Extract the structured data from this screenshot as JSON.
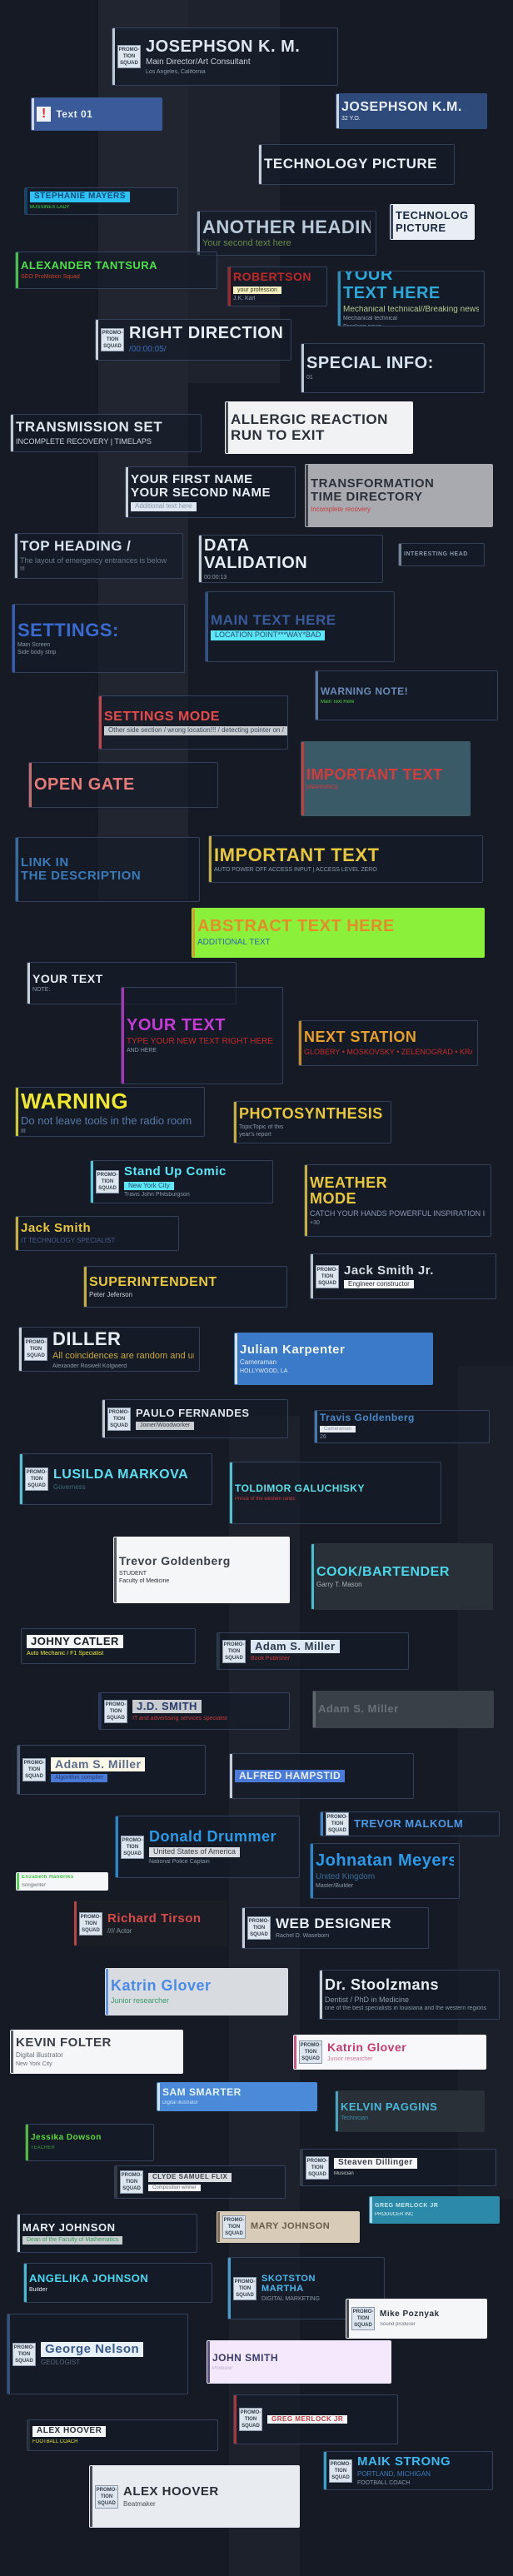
{
  "logo_text": "PROMO-TION SQUAD",
  "colors": {
    "background": "#151a25"
  },
  "lower_thirds": [
    {
      "title": "JOSEPHSON K. M.",
      "subtitle": "Main Director/Art Consultant",
      "extra": [
        "Los Angeles, California"
      ],
      "color": "#dce6f0",
      "sub_color": "#c8d2dc",
      "logo": true
    },
    {
      "title": "Text 01",
      "color": "#e6eef8",
      "bg": "#3a5a9a",
      "icon": "exclamation-icon"
    },
    {
      "title": "JOSEPHSON K.M.",
      "extra": [
        "32 Y.O."
      ],
      "color": "#e8eef6",
      "bg": "#2e4a7a"
    },
    {
      "title": "TECHNOLOGY PICTURE",
      "color": "#e8eef4"
    },
    {
      "title": "STEPHANIE MAYERS",
      "subtitle": "BUSSINES LADY",
      "color": "#0d4b7a",
      "title_bg": "#2fc3f5",
      "sub_color": "#3ddc4a"
    },
    {
      "title": "ANOTHER HEADING",
      "subtitle": "Your second text here",
      "color": "#b8c8d8",
      "sub_color": "#6a8a4a"
    },
    {
      "title": "TECHNOLOGY",
      "title2": "PICTURE",
      "color": "#1a2a40",
      "bg": "#e8eef4"
    },
    {
      "title": "ALEXANDER TANTSURA",
      "subtitle": "SEO ProMotion Squad",
      "color": "#4ee04a",
      "sub_color": "#c8402a"
    },
    {
      "title": "ROBERTSON",
      "subtitle": "your profession",
      "extra": [
        "J.K. Karl"
      ],
      "color": "#c02828",
      "sub_color": "#3a3a20",
      "sub_bg": "#f4f0c0"
    },
    {
      "title": "YOUR",
      "title2": "TEXT HERE",
      "subtitle": "Mechanical technical//Breaking news",
      "extra": [
        "Mechanical technical",
        "Breaking news"
      ],
      "color": "#2aa8d8",
      "sub_color": "#b8c890"
    },
    {
      "title": "RIGHT DIRECTION",
      "subtitle": "/00:00:05/",
      "color": "#e8eef4",
      "sub_color": "#3a6ab8",
      "logo": true
    },
    {
      "title": "SPECIAL INFO:",
      "extra": [
        "01"
      ],
      "color": "#d8e4f0"
    },
    {
      "title": "TRANSMISSION SET",
      "subtitle": "INCOMPLETE RECOVERY | TIMELAPS",
      "color": "#e0e8f0",
      "sub_color": "#c8d2dc"
    },
    {
      "title": "ALLERGIC REACTION",
      "title2": "RUN TO EXIT",
      "color": "#2a3038",
      "bg": "#f0f2f4"
    },
    {
      "title": "YOUR FIRST NAME",
      "title2": "YOUR SECOND NAME",
      "subtitle": "Additional text here",
      "color": "#e8eef6",
      "sub_color": "#8a98aa",
      "sub_bg": "#dce6f0"
    },
    {
      "title": "TRANSFORMATION",
      "title2": "TIME DIRECTORY",
      "subtitle": "Incomplete recovery",
      "color": "#2a3038",
      "bg": "#a8aab0",
      "sub_color": "#c83a3a"
    },
    {
      "title": "TOP HEADING /",
      "subtitle": "The layout of emergency entrances is below",
      "extra": [
        "!!!"
      ],
      "color": "#d8e4f0",
      "sub_color": "#6a7888"
    },
    {
      "title": "DATA",
      "title2": "VALIDATION",
      "extra": [
        "00:00:13"
      ],
      "color": "#e8eef6"
    },
    {
      "title": "INTERESTING HEAD",
      "color": "#8a98a8"
    },
    {
      "title": "SETTINGS:",
      "extra": [
        "Main Screen",
        "Side body strip"
      ],
      "color": "#3a6ad0"
    },
    {
      "title": "MAIN TEXT HERE",
      "subtitle": "LOCATION POINT***WAY*BAD",
      "color": "#3a5a9a",
      "sub_color": "#2a4a6a",
      "sub_bg": "#5ae8f8"
    },
    {
      "title": "WARNING NOTE!",
      "subtitle": "Main Text Here",
      "color": "#6a8ab8",
      "sub_color": "#4ad43a"
    },
    {
      "title": "SETTINGS MODE",
      "subtitle": "Other side section / wrong location!!! / detecting pointer on /",
      "color": "#e84a4a",
      "sub_color": "#3a4a5a",
      "sub_bg": "#c8ccd0"
    },
    {
      "title": "IMPORTANT TEXT",
      "extra": [
        "[WARNING]"
      ],
      "color": "#d83a3a",
      "bg": "#3a5a68"
    },
    {
      "title": "OPEN GATE",
      "color": "#e87a7a"
    },
    {
      "title": "LINK IN",
      "title2": "THE DESCRIPTION",
      "color": "#3a7ab8"
    },
    {
      "title": "IMPORTANT TEXT",
      "extra": [
        "AUTO POWER OFF ACCESS INPUT | ACCESS LEVEL ZERO"
      ],
      "color": "#e8c83a"
    },
    {
      "title": "ABSTRACT TEXT HERE",
      "subtitle": "ADDITIONAL TEXT",
      "color": "#e88a2a",
      "bg": "#8af03a",
      "sub_color": "#2a6aa8"
    },
    {
      "title": "YOUR TEXT",
      "extra": [
        "NOTE:"
      ],
      "color": "#e8eef6"
    },
    {
      "title": "YOUR TEXT",
      "subtitle": "TYPE YOUR NEW TEXT RIGHT HERE",
      "extra": [
        "AND HERE"
      ],
      "color": "#c83ad8",
      "sub_color": "#c82a2a"
    },
    {
      "title": "NEXT STATION",
      "subtitle": "GLOBERY • MOSKOVSKY • ZELENOGRAD • KRASNODAR",
      "color": "#e8a02a",
      "sub_color": "#c82a2a"
    },
    {
      "title": "WARNING",
      "subtitle": "Do not leave tools in the radio room",
      "extra": [
        "III"
      ],
      "color": "#f0e82a",
      "sub_color": "#5a7aa8"
    },
    {
      "title": "PHOTOSYNTHESIS",
      "extra": [
        "TopicTopic of this",
        "year's report"
      ],
      "color": "#e8c83a"
    },
    {
      "title": "Stand Up Comic",
      "subtitle": "New York City",
      "extra": [
        "Travis John Phitsburgson"
      ],
      "color": "#5ae8f8",
      "sub_color": "#2a4a6a",
      "sub_bg": "#5ae8f8",
      "logo": true
    },
    {
      "title": "WEATHER",
      "title2": "MODE",
      "subtitle": "CATCH YOUR HANDS POWERFUL INSPIRATION IS PUT INTO YOUR CREATIVE TOOLS THAT GIVE YOU ABSOLUTE CONTROL OVER YOUR TEXT THEIR HELP YOU",
      "extra": [
        "+30"
      ],
      "color": "#e8c83a",
      "sub_color": "#8a98b8"
    },
    {
      "title": "Jack Smith",
      "subtitle": "IT TECHNOLOGY SPECIALIST",
      "color": "#e8c83a",
      "sub_color": "#4a5a8a"
    },
    {
      "title": "SUPERINTENDENT",
      "subtitle": "Peter Jeferson",
      "color": "#e8c83a",
      "sub_color": "#c8d0d8"
    },
    {
      "title": "Jack Smith Jr.",
      "subtitle": "Engineer constructor",
      "color": "#d8dee6",
      "sub_color": "#2a3038",
      "sub_bg": "#f4f6f8",
      "logo": true
    },
    {
      "title": "DILLER",
      "subtitle": "All coincidences are random and undeniable",
      "extra": [
        "Alexander Roswell Kolgwerd"
      ],
      "color": "#e8eef6",
      "sub_color": "#c8a83a",
      "logo": true
    },
    {
      "title": "Julian Karpenter",
      "subtitle": "Cameraman",
      "extra": [
        "HOLLYWOOD, LA"
      ],
      "color": "#f0f4f8",
      "bg": "#3a7ac8",
      "sub_color": "#e0e8f0"
    },
    {
      "title": "PAULO FERNANDES",
      "subtitle": "Joiner/Woodworker",
      "color": "#e0e6ec",
      "sub_color": "#3a4048",
      "sub_bg": "#c8ccd0",
      "logo": true
    },
    {
      "title": "Travis Goldenberg",
      "subtitle": "Cameraman",
      "extra": [
        "26"
      ],
      "color": "#4a88c8",
      "sub_color": "#8a98a8",
      "sub_bg": "#e8ecf0"
    },
    {
      "title": "LUSILDA MARKOVA",
      "subtitle": "Governess",
      "color": "#5ae0f0",
      "sub_color": "#3a6a7a",
      "logo": true
    },
    {
      "title": "TOLDIMOR GALUCHISKY",
      "subtitle": "Prince of the western lands",
      "color": "#5ae0e8",
      "sub_color": "#c83a3a"
    },
    {
      "title": "Trevor Goldenberg",
      "subtitle": "STUDENT",
      "extra": [
        "Faculty of Medicine"
      ],
      "color": "#3a4048",
      "bg": "#f4f6f8",
      "sub_color": "#2a3038"
    },
    {
      "title": "COOK/BARTENDER",
      "subtitle": "Garry T. Mason",
      "color": "#4ad8e8",
      "bg": "#2a3038",
      "sub_color": "#a8b0b8"
    },
    {
      "title": "JOHNY CATLER",
      "subtitle": "Auto Mechanic / F1 Specialist",
      "color": "#1a1e24",
      "title_bg": "#f4f6f8",
      "sub_color": "#e8e83a"
    },
    {
      "title": "Adam S. Miller",
      "subtitle": "Book Publisher",
      "color": "#2a3848",
      "title_bg": "#dce8f4",
      "sub_color": "#c83a3a",
      "logo": true
    },
    {
      "title": "J.D. SMITH",
      "subtitle": "IT and advertising services specialist",
      "color": "#2a3a68",
      "title_bg": "#c8ccd0",
      "sub_color": "#c83a3a",
      "logo": true
    },
    {
      "title": "Adam S. Miller",
      "color": "#6a7078",
      "bg": "#3a4048"
    },
    {
      "title": "Adam S. Miller",
      "subtitle": "Algorithm compiler",
      "color": "#5a6a8a",
      "title_bg": "#fcf8e8",
      "sub_color": "#2a3a6a",
      "sub_bg": "#4a7ad8",
      "logo": true
    },
    {
      "title": "ALFRED HAMPSTID",
      "color": "#e8eef6",
      "title_bg": "#4a7ad8"
    },
    {
      "title": "TREVOR MALKOLM",
      "color": "#4a9ae8",
      "logo": true
    },
    {
      "title": "Donald Drummer",
      "subtitle": "United States of America",
      "extra": [
        "National Police Captain"
      ],
      "color": "#2a9ae8",
      "sub_color": "#3a4048",
      "sub_bg": "#d8dce0",
      "logo": true
    },
    {
      "title": "Elizabeth Handriks",
      "subtitle": "Songwriter",
      "color": "#3ac83a",
      "bg": "#f4f6f8",
      "sub_color": "#6a7078"
    },
    {
      "title": "Johnatan Meyers",
      "subtitle": "United Kingdom",
      "extra": [
        "Master/Builder"
      ],
      "color": "#2a9ae8",
      "sub_color": "#3a6a98"
    },
    {
      "title": "Richard Tirson",
      "subtitle": "//// Actor",
      "color": "#d84a4a",
      "bg": "#1a1e24",
      "sub_color": "#8a98a8",
      "logo": true
    },
    {
      "title": "WEB DESIGNER",
      "extra": [
        "Rachel D. Waseborn"
      ],
      "color": "#e8eef6",
      "logo": true
    },
    {
      "title": "Katrin Glover",
      "subtitle": "Junior researcher",
      "color": "#4a8ae8",
      "bg": "#d8dce0",
      "sub_color": "#3a9a6a"
    },
    {
      "title": "Dr. Stoolzmans",
      "subtitle": "Dentist / PhD in Medicine",
      "extra": [
        "one of the best specialists in louisiana and the western regions"
      ],
      "color": "#e8eef6",
      "sub_color": "#8a98a8"
    },
    {
      "title": "KEVIN FOLTER",
      "subtitle": "Digital illustrator",
      "extra": [
        "New York City"
      ],
      "color": "#3a4048",
      "bg": "#f4f6f8",
      "sub_color": "#6a7078"
    },
    {
      "title": "Katrin Glover",
      "subtitle": "Junior researcher",
      "color": "#c83a6a",
      "bg": "#f8f8fa",
      "sub_color": "#d87a9a",
      "logo": true
    },
    {
      "title": "SAM SMARTER",
      "subtitle": "Digital illustrator",
      "color": "#e8f4fc",
      "bg": "#4a8ad8",
      "sub_color": "#c8e0f8"
    },
    {
      "title": "KELVIN PAGGINS",
      "subtitle": "Technician",
      "color": "#4ab8d8",
      "bg": "#2a3038",
      "sub_color": "#3a8aa8"
    },
    {
      "title": "Jessika Dowson",
      "subtitle": "TEACHER",
      "color": "#5ad83a",
      "sub_color": "#3a9a3a"
    },
    {
      "title": "Steaven Dillinger",
      "subtitle": "Musician",
      "color": "#3a4048",
      "title_bg": "#f4f6f8",
      "sub_color": "#c8ccd0",
      "logo": true
    },
    {
      "title": "CLYDE SAMUEL FLIX",
      "subtitle": "Composition winner",
      "color": "#3a4048",
      "title_bg": "#d8dce0",
      "sub_color": "#6a7078",
      "sub_bg": "#f4f6f8",
      "logo": true
    },
    {
      "title": "GREG MERLOCK JR",
      "subtitle": "PRODUCER INC",
      "color": "#c8e8f0",
      "bg": "#2a8aa8",
      "sub_color": "#e8f4f8"
    },
    {
      "title": "MARY JOHNSON",
      "subtitle": "Dean of the Faculty of Mathematics",
      "color": "#e8eef6",
      "sub_color": "#3a9a5a",
      "sub_bg": "#c8ccd0"
    },
    {
      "title": "MARY JOHNSON",
      "color": "#6a5a4a",
      "bg": "#d8ccb8",
      "logo": true
    },
    {
      "title": "ANGELIKA JOHNSON",
      "subtitle": "Builder",
      "color": "#4ad8f0",
      "sub_color": "#e8eef6"
    },
    {
      "title": "SKOTSTON",
      "title2": "MARTHA",
      "extra": [
        "DIGITAL MARKETING"
      ],
      "color": "#4ab8f0",
      "logo": true
    },
    {
      "title": "Mike Poznyak",
      "subtitle": "Sound producer",
      "color": "#2a3038",
      "bg": "#f4f6f8",
      "sub_color": "#6a7078",
      "logo": true
    },
    {
      "title": "George Nelson",
      "subtitle": "GEOLOGIST",
      "color": "#3a5a8a",
      "title_bg": "#e8f0fa",
      "sub_color": "#5a6878",
      "logo": true
    },
    {
      "title": "JOHN SMITH",
      "subtitle": "Producer",
      "color": "#3a3a6a",
      "bg": "#f4e8fc",
      "sub_color": "#b8a8c8"
    },
    {
      "title": "GREG MERLOCK JR",
      "color": "#c83a3a",
      "title_bg": "#f4f6f8",
      "logo": true
    },
    {
      "title": "ALEX HOOVER",
      "subtitle": "FOOTBALL COACH",
      "color": "#2a3038",
      "title_bg": "#f4f6f8",
      "sub_color": "#e8e83a"
    },
    {
      "title": "MAIK STRONG",
      "subtitle": "PORTLAND, MICHIGAN",
      "extra": [
        "FOOTBALL COACH"
      ],
      "color": "#3ab8f0",
      "sub_color": "#3a7ab8",
      "logo": true
    },
    {
      "title": "ALEX HOOVER",
      "subtitle": "Beatmaker",
      "color": "#2a3038",
      "bg": "#e8ecf0",
      "sub_color": "#4a5058",
      "logo": true
    }
  ]
}
